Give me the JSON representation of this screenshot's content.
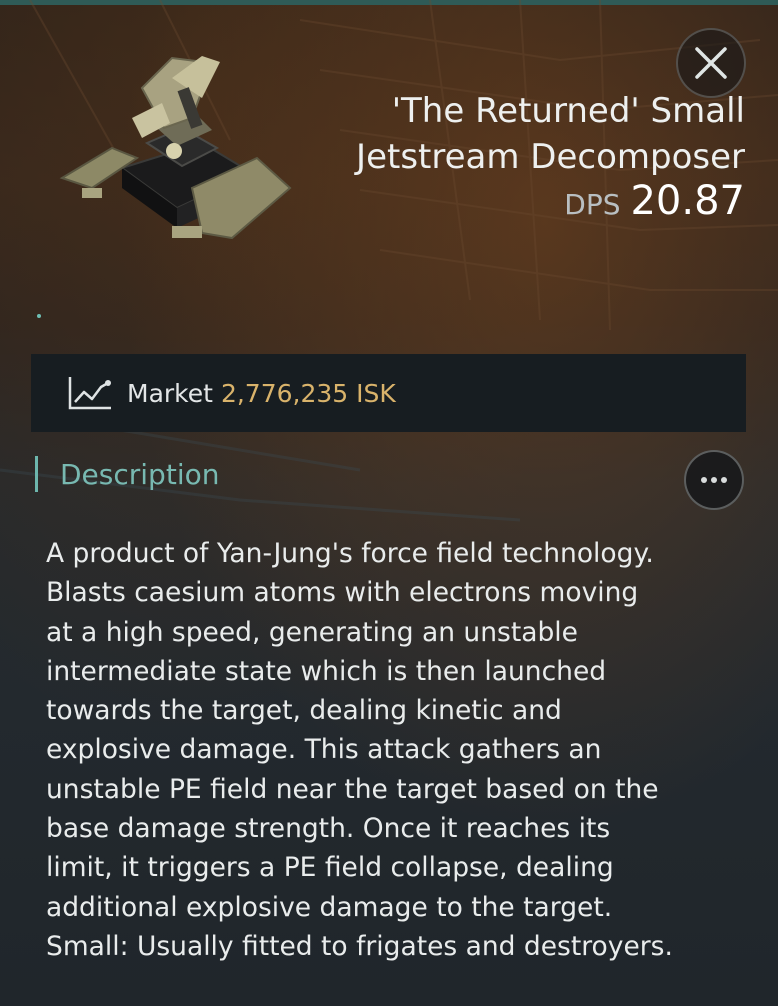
{
  "item": {
    "name_line1": "'The Returned' Small",
    "name_line2": "Jetstream Decomposer",
    "dps_label": "DPS",
    "dps_value": "20.87",
    "image_icon": "turret-weapon-image"
  },
  "close_button": {
    "icon": "close-icon"
  },
  "market": {
    "icon": "market-chart-icon",
    "label": "Market",
    "value": "2,776,235 ISK"
  },
  "description": {
    "title": "Description",
    "more_icon": "more-options-icon",
    "lines": [
      "A product of Yan-Jung's force field technology.",
      "Blasts caesium atoms with electrons moving",
      "at a high speed, generating an unstable",
      "intermediate state which is then launched",
      "towards the target, dealing kinetic and",
      "explosive damage. This attack gathers an",
      "unstable PE field near the target based on the",
      "base damage strength. Once it reaches its",
      "limit, it triggers a PE field collapse, dealing",
      "additional explosive damage to the target.",
      "Small: Usually fitted to frigates and destroyers."
    ]
  },
  "colors": {
    "accent": "#78b9b1",
    "market_value": "#d9b36b",
    "panel": "#171d21"
  }
}
